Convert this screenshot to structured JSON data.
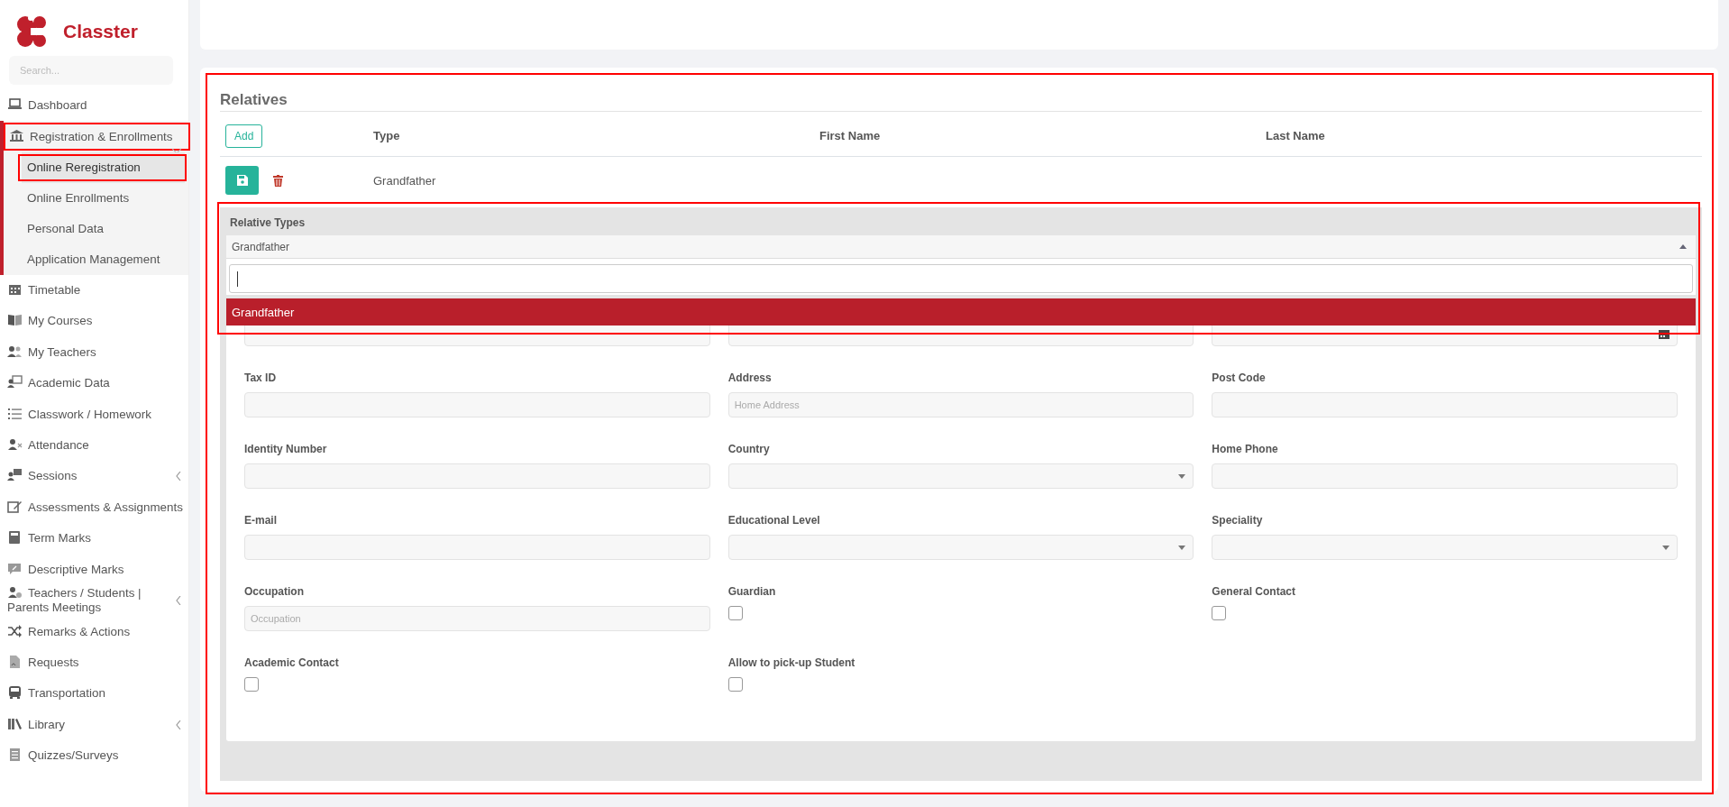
{
  "brand": {
    "name": "Classter"
  },
  "sidebar": {
    "search": {
      "placeholder": "Search..."
    },
    "items": [
      {
        "label": "Dashboard",
        "selected": false,
        "has_submenu": false
      },
      {
        "label": "Registration & Enrollments",
        "selected": false,
        "highlighted": true,
        "expanded": true,
        "children": [
          {
            "label": "Online Reregistration",
            "selected": true,
            "highlighted": true
          },
          {
            "label": "Online Enrollments",
            "selected": false,
            "highlighted": false
          },
          {
            "label": "Personal Data",
            "selected": false,
            "highlighted": false
          },
          {
            "label": "Application Management",
            "selected": false,
            "highlighted": false
          }
        ]
      },
      {
        "label": "Timetable",
        "selected": false,
        "has_submenu": false
      },
      {
        "label": "My Courses",
        "selected": false,
        "has_submenu": false
      },
      {
        "label": "My Teachers",
        "selected": false,
        "has_submenu": false
      },
      {
        "label": "Academic Data",
        "selected": false,
        "has_submenu": false
      },
      {
        "label": "Classwork / Homework",
        "selected": false,
        "has_submenu": false
      },
      {
        "label": "Attendance",
        "selected": false,
        "has_submenu": false
      },
      {
        "label": "Sessions",
        "selected": false,
        "has_submenu": true
      },
      {
        "label": "Assessments & Assignments",
        "selected": false,
        "has_submenu": false
      },
      {
        "label": "Term Marks",
        "selected": false,
        "has_submenu": false
      },
      {
        "label": "Descriptive Marks",
        "selected": false,
        "has_submenu": false
      },
      {
        "label": "Teachers / Students | Parents Meetings",
        "selected": false,
        "has_submenu": true
      },
      {
        "label": "Remarks & Actions",
        "selected": false,
        "has_submenu": false
      },
      {
        "label": "Requests",
        "selected": false,
        "has_submenu": false
      },
      {
        "label": "Transportation",
        "selected": false,
        "has_submenu": false
      },
      {
        "label": "Library",
        "selected": false,
        "has_submenu": true
      },
      {
        "label": "Quizzes/Surveys",
        "selected": false,
        "has_submenu": false
      }
    ]
  },
  "relatives": {
    "title": "Relatives",
    "highlighted": true,
    "add_button": "Add",
    "columns": [
      "Type",
      "First Name",
      "Last Name"
    ],
    "rows": [
      {
        "type": "Grandfather",
        "first_name": "",
        "last_name": ""
      }
    ],
    "dropdown": {
      "label": "Relative Types",
      "value": "Grandfather",
      "highlighted": true,
      "options": [
        {
          "label": "Grandfather",
          "selected": true
        }
      ]
    },
    "fields": [
      {
        "kind": "text"
      },
      {
        "kind": "text"
      },
      {
        "kind": "date"
      },
      {
        "kind": "text",
        "label": "Tax ID"
      },
      {
        "kind": "text",
        "label": "Address",
        "placeholder": "Home Address"
      },
      {
        "kind": "text",
        "label": "Post Code"
      },
      {
        "kind": "text",
        "label": "Identity Number"
      },
      {
        "kind": "select",
        "label": "Country"
      },
      {
        "kind": "text",
        "label": "Home Phone"
      },
      {
        "kind": "text",
        "label": "E-mail"
      },
      {
        "kind": "select",
        "label": "Educational Level"
      },
      {
        "kind": "select",
        "label": "Speciality"
      },
      {
        "kind": "text",
        "label": "Occupation",
        "placeholder": "Occupation"
      },
      {
        "kind": "checkbox",
        "label": "Guardian",
        "checked": false
      },
      {
        "kind": "checkbox",
        "label": "General Contact",
        "checked": false
      },
      {
        "kind": "checkbox",
        "label": "Academic Contact",
        "checked": false
      },
      {
        "kind": "checkbox",
        "label": "Allow to pick-up Student",
        "checked": false
      }
    ]
  }
}
